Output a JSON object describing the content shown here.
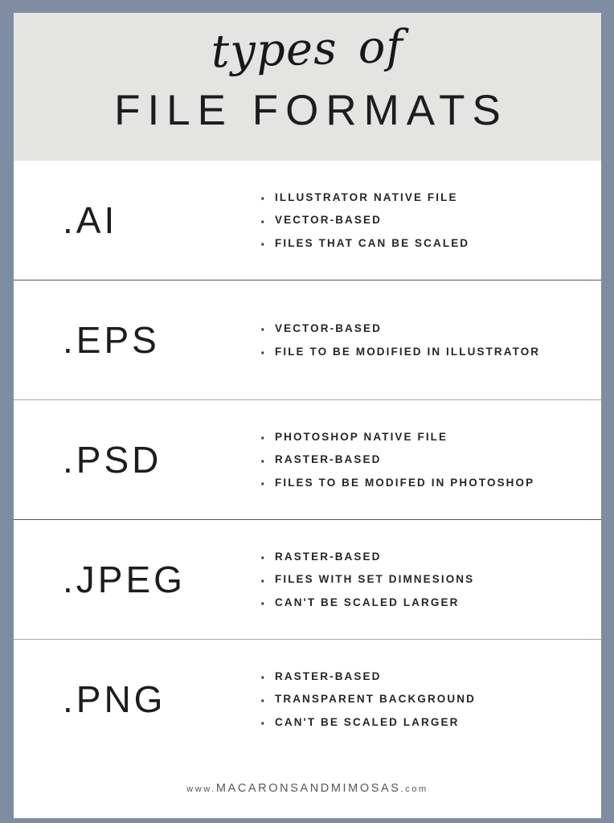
{
  "theme": {
    "frame_color": "#7f8da3",
    "header_bg": "#e4e4e3",
    "page_bg": "#ffffff",
    "text_color": "#1d1d1f",
    "bullet_text_color": "#262628",
    "divider_dark": "#56565a",
    "divider_light": "#a8a8ac",
    "footer_color": "#58585c"
  },
  "header": {
    "script_word_1": "types",
    "script_word_2": "of",
    "main_title": "FILE FORMATS"
  },
  "rows": [
    {
      "extension": ".AI",
      "bullets": [
        "Illustrator native file",
        "Vector-based",
        "Files that can be scaled"
      ]
    },
    {
      "extension": ".EPS",
      "bullets": [
        "Vector-based",
        "File to be modified in Illustrator"
      ]
    },
    {
      "extension": ".PSD",
      "bullets": [
        "Photoshop native file",
        "Raster-based",
        "Files to be modifed in Photoshop"
      ]
    },
    {
      "extension": ".JPEG",
      "bullets": [
        "Raster-based",
        "Files with set dimnesions",
        "Can't be scaled larger"
      ]
    },
    {
      "extension": ".PNG",
      "bullets": [
        "Raster-based",
        "Transparent background",
        "Can't be scaled larger"
      ]
    }
  ],
  "footer": {
    "url_prefix": "www.",
    "url_domain": "MACARONSANDMIMOSAS",
    "url_suffix": ".com"
  }
}
